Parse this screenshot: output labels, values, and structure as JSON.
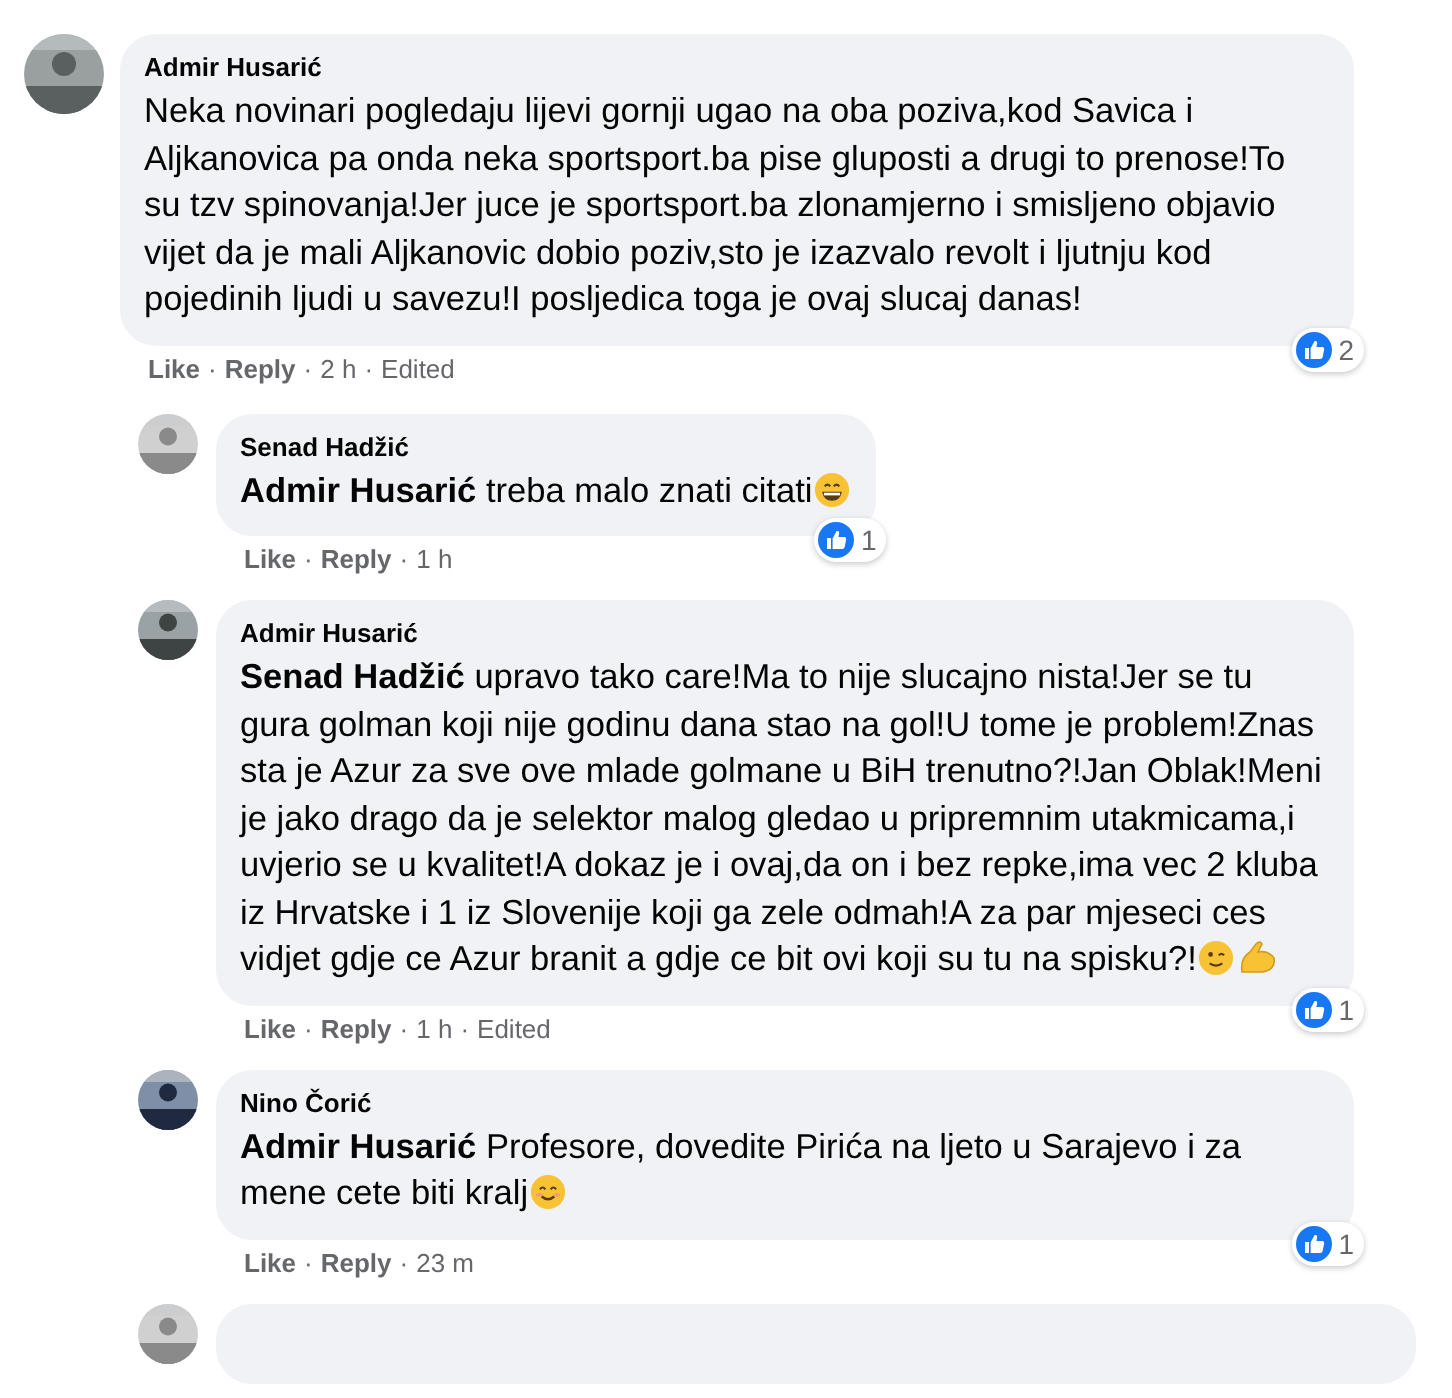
{
  "separator": "·",
  "comments": [
    {
      "author": "Admir Husarić",
      "avatar": {
        "kind": "picture"
      },
      "text": "Neka novinari pogledaju lijevi gornji ugao na oba poziva,kod Savica i Aljkanovica pa onda neka sportsport.ba pise gluposti a drugi to prenose!To su tzv spinovanja!Jer juce je sportsport.ba zlonamjerno i smisljeno objavio vijet da je mali Aljkanovic dobio poziv,sto je izazvalo revolt i ljutnju kod pojedinih ljudi u savezu!I posljedica toga je ovaj slucaj danas!",
      "meta": [
        "Like",
        "Reply",
        "2 h",
        "Edited"
      ],
      "reactions": "2",
      "children": [
        {
          "author": "Senad Hadžić",
          "avatar": {
            "kind": "picture"
          },
          "mention": "Admir Husarić",
          "text": "treba malo znati citati",
          "emojis": [
            {
              "kind": "grin"
            }
          ],
          "meta": [
            "Like",
            "Reply",
            "1 h"
          ],
          "reactions": "1"
        },
        {
          "author": "Admir Husarić",
          "avatar": {
            "kind": "picture"
          },
          "mention": "Senad Hadžić",
          "text": "upravo tako care!Ma to nije slucajno nista!Jer se tu gura golman koji nije godinu dana stao na gol!U tome je problem!Znas sta je Azur za sve ove mlade golmane u BiH trenutno?!Jan Oblak!Meni je jako drago da je selektor malog gledao u pripremnim utakmicama,i uvjerio se u kvalitet!A dokaz je i ovaj,da on i bez repke,ima vec 2 kluba iz Hrvatske i 1 iz Slovenije koji ga zele odmah!A za par mjeseci ces vidjet gdje ce Azur branit a gdje ce bit ovi koji su tu na spisku?!",
          "emojis": [
            {
              "kind": "wink"
            },
            {
              "kind": "flex"
            }
          ],
          "meta": [
            "Like",
            "Reply",
            "1 h",
            "Edited"
          ],
          "reactions": "1"
        },
        {
          "author": "Nino Čorić",
          "avatar": {
            "kind": "picture"
          },
          "mention": "Admir Husarić",
          "text": "Profesore, dovedite Pirića na ljeto u Sarajevo i za mene cete biti kralj",
          "emojis": [
            {
              "kind": "smile"
            }
          ],
          "meta": [
            "Like",
            "Reply",
            "23 m"
          ],
          "reactions": "1"
        }
      ]
    }
  ],
  "next_reply_visible": true
}
